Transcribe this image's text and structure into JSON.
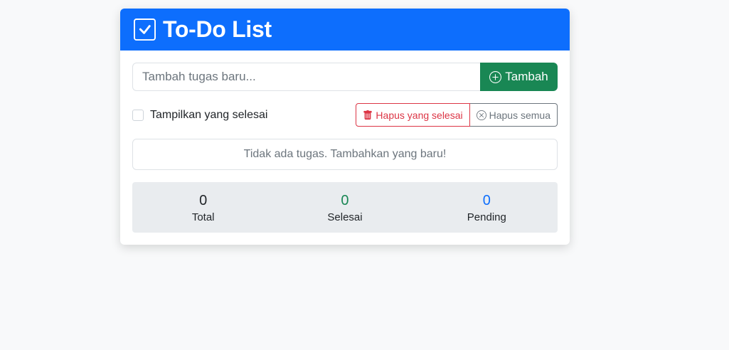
{
  "header": {
    "title": "To-Do List",
    "icon": "check-square-icon",
    "color": "#0d6efd"
  },
  "input": {
    "placeholder": "Tambah tugas baru...",
    "value": ""
  },
  "add_button": {
    "label": "Tambah",
    "icon": "plus-circle-icon",
    "color": "#198754"
  },
  "filter": {
    "label": "Tampilkan yang selesai",
    "checked": false
  },
  "actions": {
    "clear_completed": {
      "label": "Hapus yang selesai",
      "icon": "trash-icon",
      "color": "#dc3545"
    },
    "clear_all": {
      "label": "Hapus semua",
      "icon": "x-circle-icon",
      "color": "#6c757d"
    }
  },
  "empty_message": "Tidak ada tugas. Tambahkan yang baru!",
  "stats": {
    "total": {
      "value": "0",
      "label": "Total",
      "color": "#212529"
    },
    "completed": {
      "value": "0",
      "label": "Selesai",
      "color": "#198754"
    },
    "pending": {
      "value": "0",
      "label": "Pending",
      "color": "#0d6efd"
    }
  }
}
